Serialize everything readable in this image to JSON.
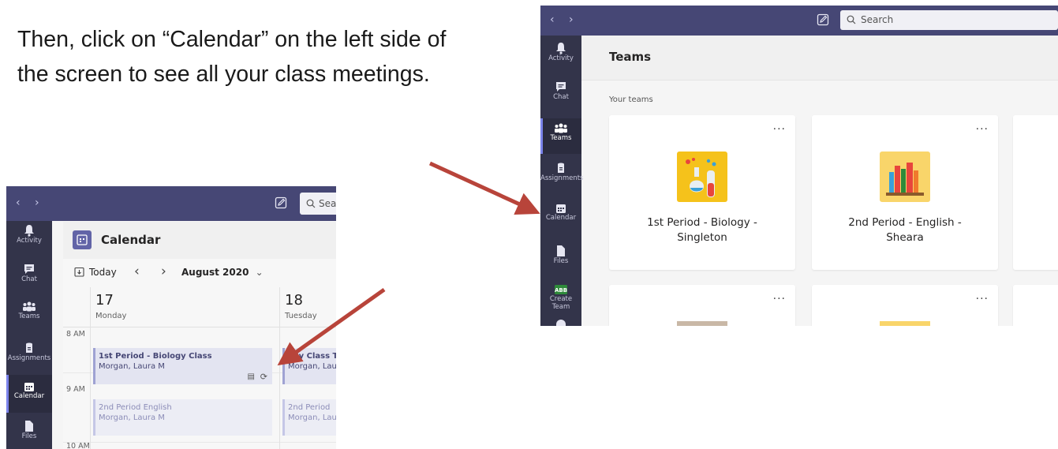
{
  "instruction": {
    "line1": "Then, click on “Calendar” on the left side of",
    "line2": "the screen to see all your class meetings."
  },
  "accent_colors": {
    "titlebar": "#464775",
    "rail": "#33344a",
    "arrow": "#b8443a",
    "brand": "#6264a7"
  },
  "rail_items": [
    "Activity",
    "Chat",
    "Teams",
    "Assignments",
    "Calendar",
    "Files",
    "Create Team"
  ],
  "calendar_window": {
    "search_placeholder": "Sea",
    "header_title": "Calendar",
    "today_label": "Today",
    "month_label": "August 2020",
    "days": [
      {
        "num": "17",
        "name": "Monday"
      },
      {
        "num": "18",
        "name": "Tuesday"
      }
    ],
    "times": [
      "8 AM",
      "9 AM",
      "10 AM"
    ],
    "events": [
      {
        "title": "1st Period - Biology Class",
        "organizer": "Morgan, Laura M"
      },
      {
        "title": "aily Class T",
        "organizer": "Morgan, Lau"
      },
      {
        "title": "2nd Period English",
        "organizer": "Morgan, Laura M"
      },
      {
        "title": "2nd Period",
        "organizer": "Morgan, Lau"
      }
    ]
  },
  "teams_window": {
    "search_placeholder": "Search",
    "header_title": "Teams",
    "section_label": "Your teams",
    "teams": [
      {
        "name_line1": "1st Period - Biology -",
        "name_line2": "Singleton",
        "icon": "flask-icon"
      },
      {
        "name_line1": "2nd Period - English -",
        "name_line2": "Sheara",
        "icon": "books-icon"
      }
    ],
    "more_label": "···"
  }
}
